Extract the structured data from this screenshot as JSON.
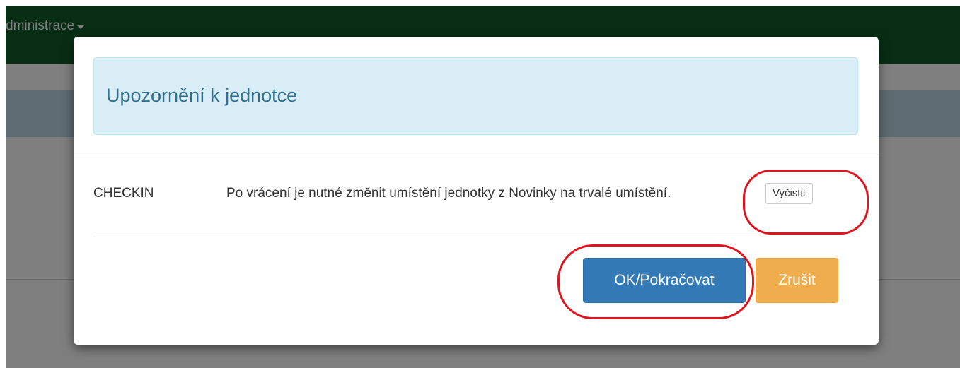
{
  "navbar": {
    "menu_label": "dministrace"
  },
  "modal": {
    "title": "Upozornění k jednotce",
    "rows": [
      {
        "code": "CHECKIN",
        "message": "Po vrácení je nutné změnit umístění jednotky z Novinky na trvalé umístění.",
        "clear_label": "Vyčistit"
      }
    ],
    "ok_label": "OK/Pokračovat",
    "cancel_label": "Zrušit"
  },
  "colors": {
    "navbar": "#0f5c2a",
    "alert_bg": "#d9edf7",
    "alert_text": "#31708f",
    "primary": "#337ab7",
    "warning": "#f0ad4e",
    "annotation": "#e0141e"
  }
}
